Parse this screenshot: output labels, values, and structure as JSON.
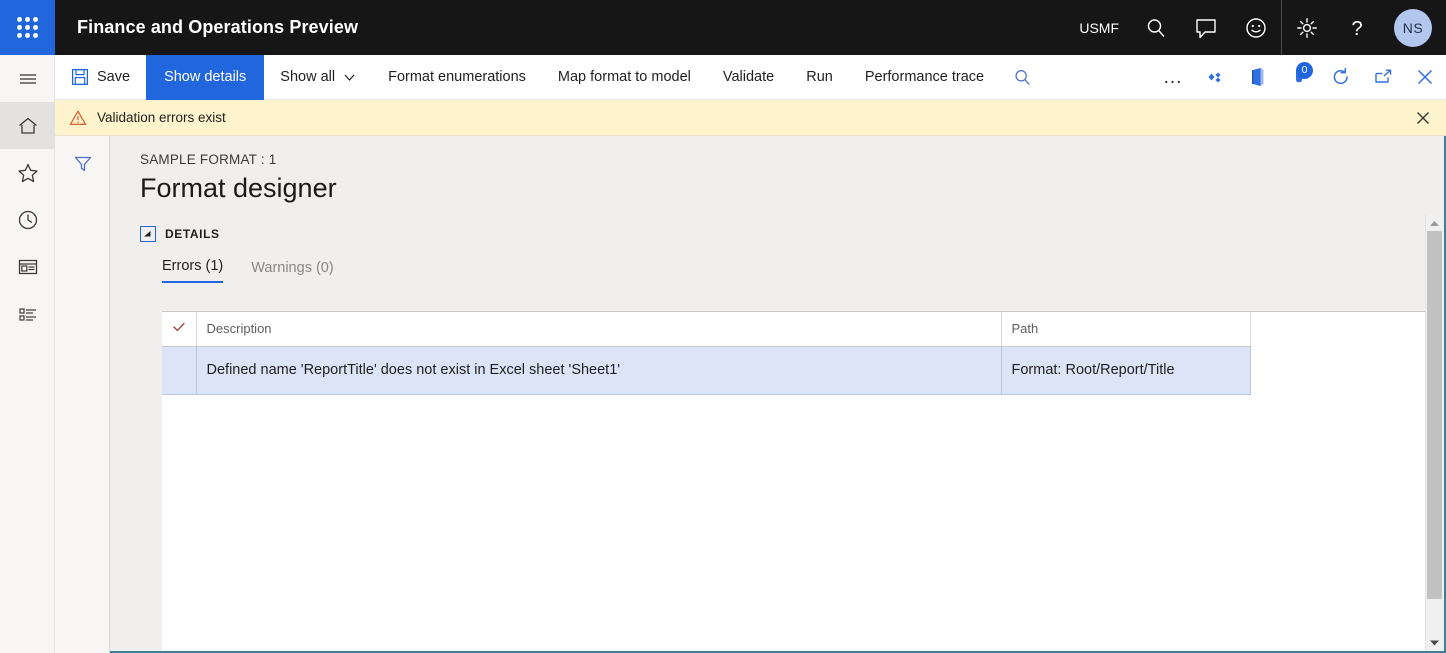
{
  "topbar": {
    "waffle_label": "app-launcher",
    "title": "Finance and Operations Preview",
    "company": "USMF",
    "search_icon": "search-icon",
    "feedback_icon": "speech-bubble-icon",
    "smiley_icon": "smiley-icon",
    "settings_icon": "gear-icon",
    "help_icon": "question-mark-icon",
    "avatar_initials": "NS"
  },
  "rail": {
    "items": [
      {
        "name": "hamburger-menu",
        "icon": "hamburger-icon",
        "active": false
      },
      {
        "name": "home",
        "icon": "home-icon",
        "active": true
      },
      {
        "name": "favorites",
        "icon": "star-icon",
        "active": false
      },
      {
        "name": "recent",
        "icon": "clock-icon",
        "active": false
      },
      {
        "name": "workspaces",
        "icon": "workspace-icon",
        "active": false
      },
      {
        "name": "modules",
        "icon": "list-icon",
        "active": false
      }
    ]
  },
  "toolbar": {
    "save_label": "Save",
    "save_icon": "save-disk-icon",
    "show_details_label": "Show details",
    "show_all_label": "Show all",
    "show_all_chevron": "chevron-down-icon",
    "format_enumerations_label": "Format enumerations",
    "map_format_to_model_label": "Map format to model",
    "validate_label": "Validate",
    "run_label": "Run",
    "performance_trace_label": "Performance trace",
    "search_icon": "search-icon",
    "overflow_label": "...",
    "attachments_icon": "diamond-cluster-icon",
    "office_icon": "open-in-office-icon",
    "notifications_icon": "notifications-bell-icon",
    "notifications_count": "0",
    "refresh_icon": "refresh-icon",
    "popout_icon": "open-in-new-window-icon",
    "close_icon": "close-icon",
    "accent_color": "#2266dd"
  },
  "message_bar": {
    "warning_icon": "warning-triangle-icon",
    "text": "Validation errors exist",
    "close_icon": "close-icon",
    "background_color": "#fdf4cd"
  },
  "filter_pane": {
    "filter_icon": "funnel-filter-icon"
  },
  "page": {
    "caption": "SAMPLE FORMAT : 1",
    "title": "Format designer",
    "section_label": "DETAILS",
    "expander_icon": "collapse-triangle-icon"
  },
  "tabs": [
    {
      "label": "Errors (1)",
      "active": true,
      "name": "tab-errors"
    },
    {
      "label": "Warnings (0)",
      "active": false,
      "name": "tab-warnings"
    }
  ],
  "grid": {
    "select_all_icon": "checkmark-icon",
    "columns": [
      "Description",
      "Path"
    ],
    "rows": [
      {
        "description": "Defined name 'ReportTitle' does not exist in Excel sheet 'Sheet1'",
        "path": "Format: Root/Report/Title",
        "selected": true
      }
    ],
    "selected_row_color": "#dbe5f7"
  },
  "scrollbar": {
    "up_icon": "scroll-up-arrow-icon",
    "down_icon": "scroll-down-arrow-icon",
    "thumb": "scrollbar-thumb"
  }
}
